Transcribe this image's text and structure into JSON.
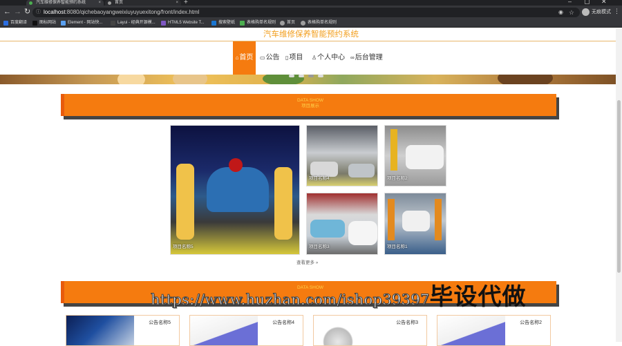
{
  "browser": {
    "tabs": [
      {
        "title": "汽车维修保养智能预约系统",
        "close": "×"
      },
      {
        "title": "首页",
        "close": "×"
      }
    ],
    "new_tab": "+",
    "url_host": "localhost",
    "url_path": ":8080/qichebaoyangweixiuyuyuexitong/front/index.html",
    "profile": "无痕模式",
    "bookmarks": [
      {
        "label": "百度翻译",
        "color": "#2a6de0"
      },
      {
        "label": "图标网站",
        "color": "#222222"
      },
      {
        "label": "Element - 网站快...",
        "color": "#5aa0f0"
      },
      {
        "label": "Layui - 经典开源模...",
        "color": "#333333"
      },
      {
        "label": "HTML5 Website T...",
        "color": "#7e57c2"
      },
      {
        "label": "搜索壁纸",
        "color": "#1976d2"
      },
      {
        "label": "表格购单名规则",
        "color": "#4caf50"
      },
      {
        "label": "首页",
        "color": "#9e9e9e"
      },
      {
        "label": "表格购单名规则",
        "color": "#9e9e9e"
      }
    ]
  },
  "site": {
    "title": "汽车维修保养智能预约系统"
  },
  "nav": [
    {
      "label": "首页",
      "icon": "home-icon",
      "glyph": "⌂",
      "active": true
    },
    {
      "label": "公告",
      "icon": "notice-icon",
      "glyph": "▭",
      "active": false
    },
    {
      "label": "项目",
      "icon": "grid-icon",
      "glyph": "▯",
      "active": false
    },
    {
      "label": "个人中心",
      "icon": "user-icon",
      "glyph": "♙",
      "active": false
    },
    {
      "label": "后台管理",
      "icon": "link-icon",
      "glyph": "🔗",
      "active": false
    }
  ],
  "section1": {
    "en": "DATA SHOW",
    "cn": "项目展示"
  },
  "projects": [
    {
      "caption": "项目名称5"
    },
    {
      "caption": "项目名称4"
    },
    {
      "caption": "项目名称2"
    },
    {
      "caption": "项目名称3"
    },
    {
      "caption": "项目名称1"
    }
  ],
  "more": "查看更多 »",
  "section2": {
    "en": "DATA SHOW"
  },
  "watermark": {
    "url": "https://www.huzhan.com/ishop39397",
    "text": "毕设代做"
  },
  "notices": [
    {
      "title": "公告名称5"
    },
    {
      "title": "公告名称4"
    },
    {
      "title": "公告名称3"
    },
    {
      "title": "公告名称2"
    }
  ],
  "colors": {
    "accent": "#f57b0f",
    "title": "#f29f1f",
    "section_text": "#ffd24a"
  }
}
